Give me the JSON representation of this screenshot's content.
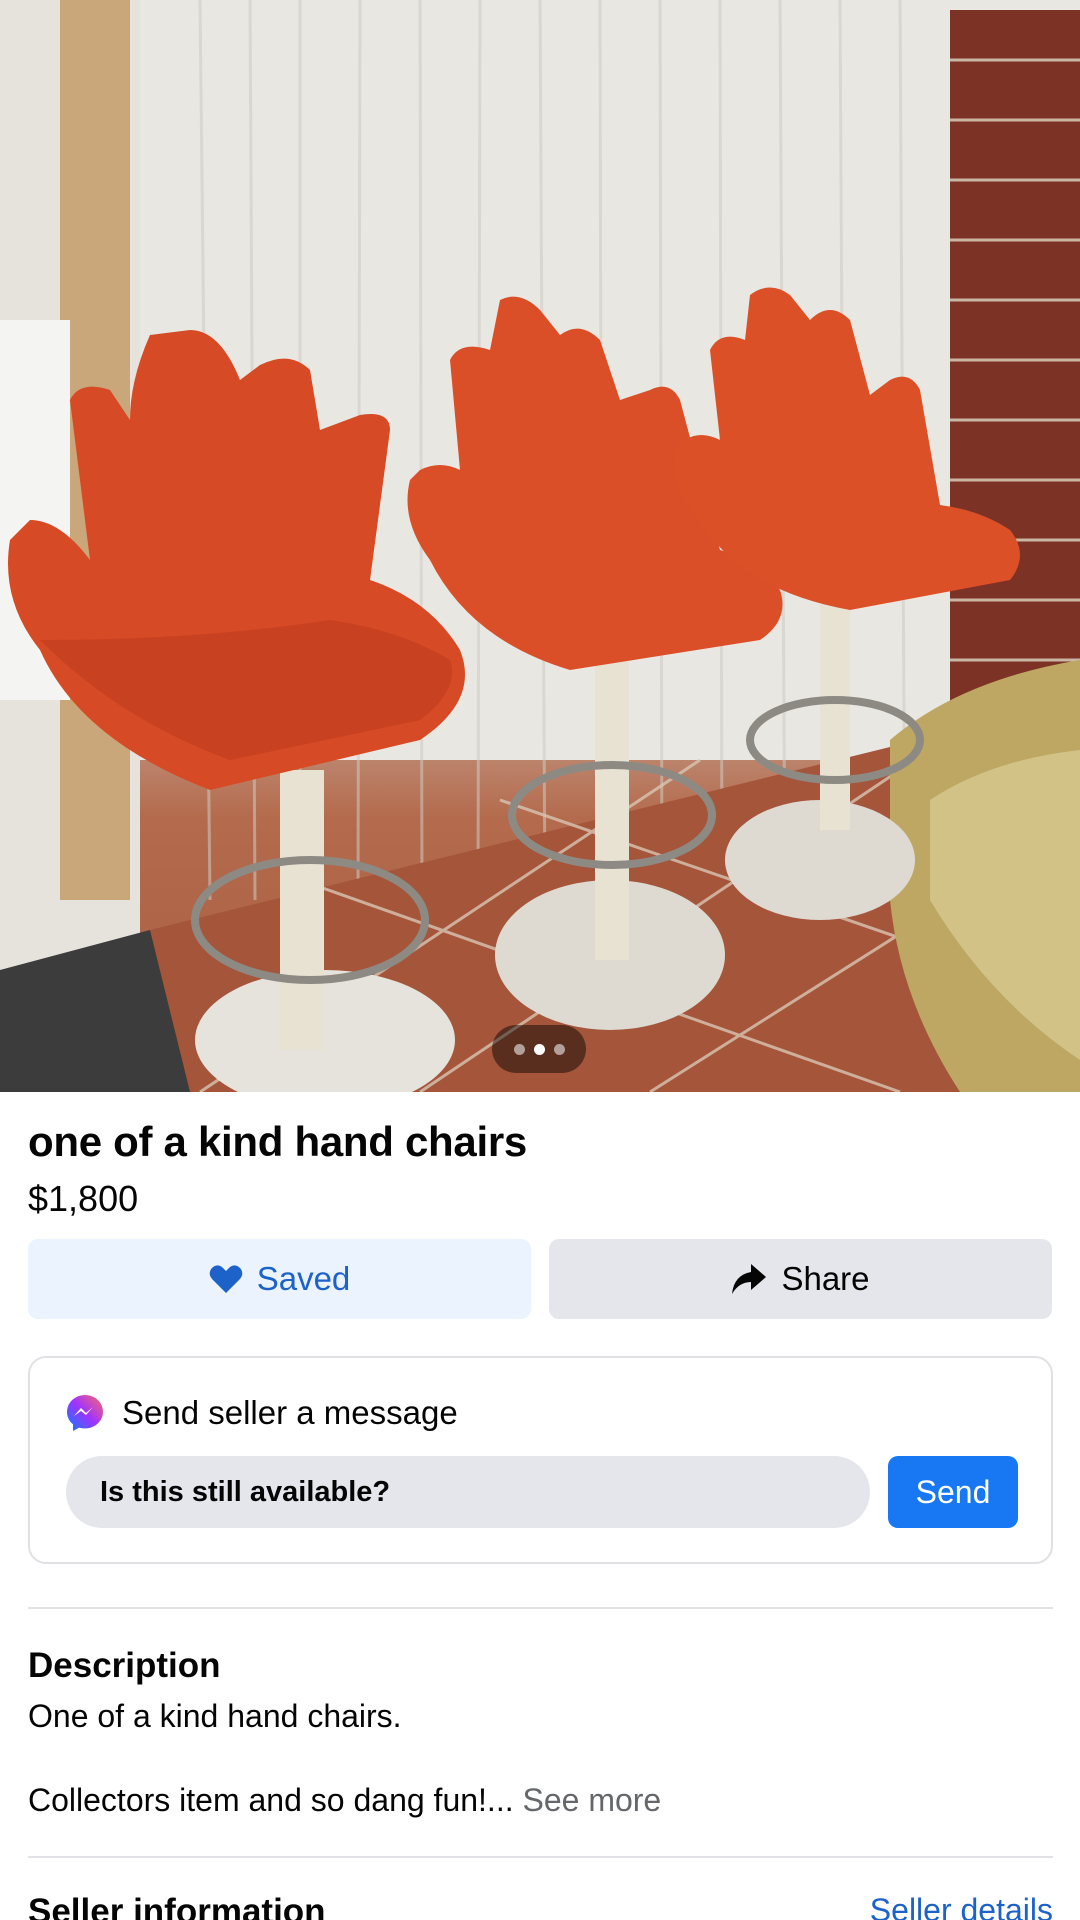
{
  "listing": {
    "title": "one of a kind hand chairs",
    "price": "$1,800",
    "photo": {
      "dots_total": 3,
      "active_dot": 2
    }
  },
  "actions": {
    "saved_label": "Saved",
    "share_label": "Share"
  },
  "message": {
    "header": "Send seller a message",
    "input_value": "Is this still available?",
    "send_label": "Send"
  },
  "description": {
    "heading": "Description",
    "line1": "One of a kind hand chairs.",
    "line2": "Collectors item and so dang fun!...",
    "see_more": "See more"
  },
  "seller": {
    "heading": "Seller information",
    "details_link": "Seller details"
  },
  "colors": {
    "accent": "#1877f2",
    "saved_bg": "#eaf3fe",
    "saved_text": "#1d62c9",
    "neutral_button": "#e4e6eb"
  },
  "icons": [
    "heart-icon",
    "share-arrow-icon",
    "messenger-icon"
  ]
}
